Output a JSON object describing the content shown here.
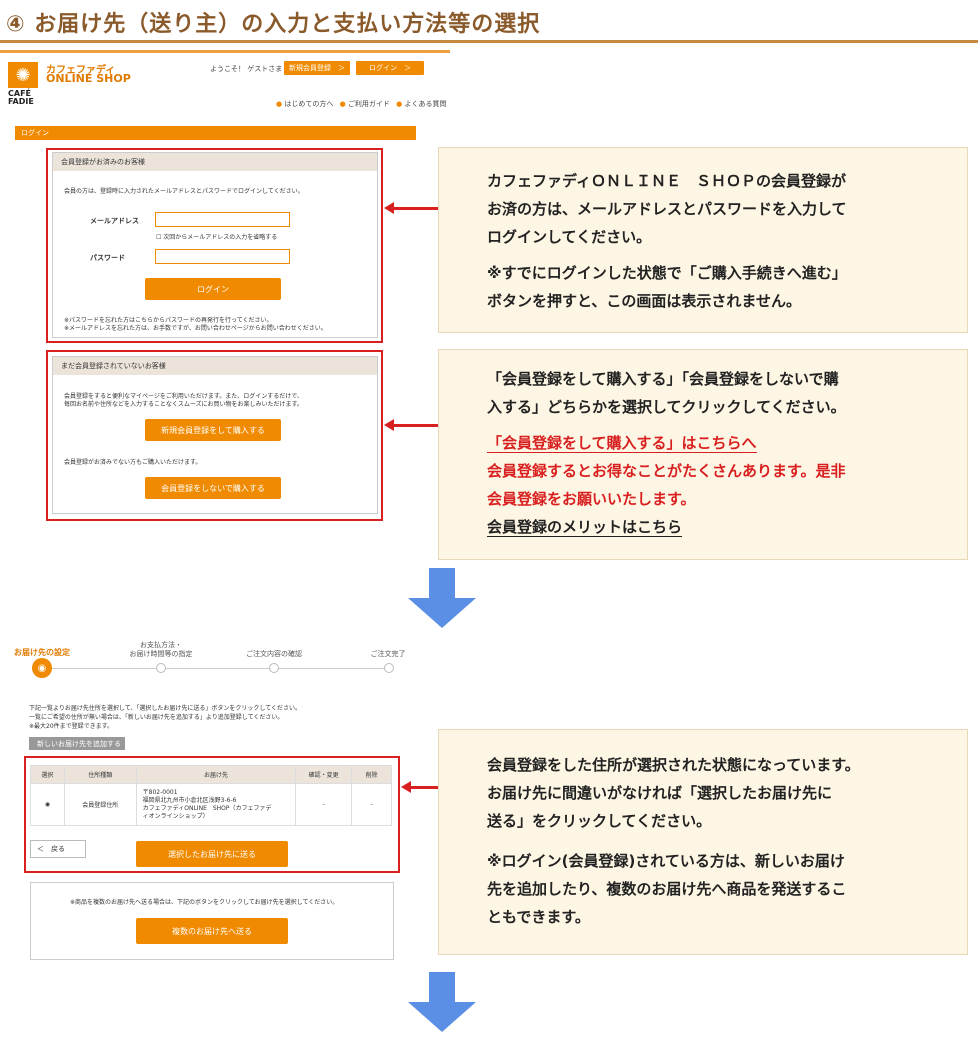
{
  "title": "④ お届け先（送り主）の入力と支払い方法等の選択",
  "shop": {
    "brand_line1": "カフェファディ",
    "brand_line2": "ONLINE SHOP",
    "logo_text": "CAFÉ\nFADIE",
    "welcome": "ようこそ！ ゲストさま",
    "register_btn": "新規会員登録　＞",
    "login_btn": "ログイン　＞",
    "nav_first": "はじめての方へ",
    "nav_guide": "ご利用ガイド",
    "nav_faq": "よくある質問",
    "login_bar": "ログイン"
  },
  "member_panel": {
    "heading": "会員登録がお済みのお客様",
    "intro": "会員の方は、登録時に入力されたメールアドレスとパスワードでログインしてください。",
    "email_label": "メールアドレス",
    "remember": "次回からメールアドレスの入力を省略する",
    "password_label": "パスワード",
    "login_button": "ログイン",
    "note1": "※パスワードを忘れた方はこちらからパスワードの再発行を行ってください。",
    "note2": "※メールアドレスを忘れた方は、お手数ですが、お問い合わせページからお問い合わせください。"
  },
  "guest_panel": {
    "heading": "まだ会員登録されていないお客様",
    "intro1": "会員登録をすると便利なマイページをご利用いただけます。また、ログインするだけで、",
    "intro2": "毎回お名前や住所などを入力することなくスムーズにお買い物をお楽しみいただけます。",
    "register_button": "新規会員登録をして購入する",
    "guest_note": "会員登録がお済みでない方もご購入いただけます。",
    "guest_button": "会員登録をしないで購入する"
  },
  "info1": {
    "line1": "カフェファディＯＮＬＩＮＥ　ＳＨＯＰの会員登録が",
    "line2": "お済の方は、メールアドレスとパスワードを入力して",
    "line3": "ログインしてください。",
    "line4": "※すでにログインした状態で「ご購入手続きへ進む」",
    "line5": "ボタンを押すと、この画面は表示されません。"
  },
  "info2": {
    "line1": "「会員登録をして購入する」「会員登録をしないで購",
    "line2": "入する」どちらかを選択してクリックしてください。",
    "link": "「会員登録をして購入する」はこちらへ",
    "red1": "会員登録するとお得なことがたくさんあります。是非",
    "red2": "会員登録をお願いいたします。",
    "merit_link": "会員登録のメリットはこちら"
  },
  "steps": {
    "s1": "お届け先の設定",
    "s2a": "お支払方法・",
    "s2b": "お届け時間等の指定",
    "s3": "ご注文内容の確認",
    "s4": "ご注文完了"
  },
  "addr_intro": {
    "l1": "下記一覧よりお届け先住所を選択して、「選択したお届け先に送る」ボタンをクリックしてください。",
    "l2": "一覧にご希望の住所が無い場合は、「新しいお届け先を追加する」より追加登録してください。",
    "l3": "※最大20件まで登録できます。",
    "add_btn": "新しいお届け先を追加する　＞"
  },
  "addr_table": {
    "headers": [
      "選択",
      "住所種類",
      "お届け先",
      "確認・変更",
      "削除"
    ],
    "radio": "◉",
    "type": "会員登録住所",
    "addr1": "〒802-0001",
    "addr2": "福岡県北九州市小倉北区浅野3-6-6",
    "addr3": "カフェファディONLINE　SHOP（カフェファデ",
    "addr4": "ィオンラインショップ）",
    "confirm": "-",
    "delete": "-"
  },
  "addr_actions": {
    "back": "＜　戻る",
    "send": "選択したお届け先に送る",
    "multi_note": "※商品を複数のお届け先へ送る場合は、下記のボタンをクリックしてお届け先を選択してください。",
    "multi_btn": "複数のお届け先へ送る"
  },
  "info3": {
    "line1": "会員登録をした住所が選択された状態になっています。",
    "line2": "お届け先に間違いがなければ「選択したお届け先に",
    "line3": "送る」をクリックしてください。",
    "line4": "※ログイン(会員登録)されている方は、新しいお届け",
    "line5": "先を追加したり、複数のお届け先へ商品を発送するこ",
    "line6": "ともできます。"
  },
  "icons": {
    "logo": "sun-logo-icon",
    "pin": "location-pin-icon",
    "arrow_down": "arrow-down-icon",
    "arrow_left": "arrow-left-icon"
  },
  "colors": {
    "accent": "#f08a00",
    "highlight": "#d92020",
    "arrow": "#5b8fe6",
    "info_bg": "#fdf6e4"
  }
}
